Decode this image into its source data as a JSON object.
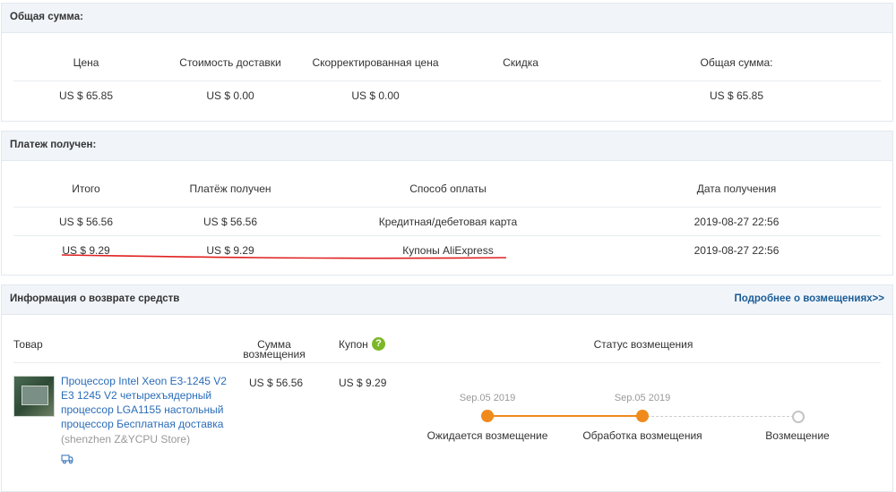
{
  "summary": {
    "title": "Общая сумма:",
    "headers": [
      "Цена",
      "Стоимость доставки",
      "Скорректированная цена",
      "Скидка",
      "Общая сумма:"
    ],
    "values": [
      "US $ 65.85",
      "US $ 0.00",
      "US $ 0.00",
      "",
      "US $ 65.85"
    ]
  },
  "payment": {
    "title": "Платеж получен:",
    "headers": [
      "Итого",
      "Платёж получен",
      "Способ оплаты",
      "Дата получения"
    ],
    "rows": [
      [
        "US $ 56.56",
        "US $ 56.56",
        "Кредитная/дебетовая карта",
        "2019-08-27 22:56"
      ],
      [
        "US $ 9.29",
        "US $ 9.29",
        "Купоны AliExpress",
        "2019-08-27 22:56"
      ]
    ]
  },
  "refund": {
    "title": "Информация о возврате средств",
    "details_link": "Подробнее о возмещениях>>",
    "headers": {
      "product": "Товар",
      "amount_line1": "Сумма",
      "amount_line2": "возмещения",
      "coupon": "Купон",
      "status": "Статус возмещения"
    },
    "item": {
      "title": "Процессор Intel Xeon E3-1245 V2 E3 1245 V2 четырехъядерный процессор LGA1155 настольный процессор Бесплатная доставка",
      "store": "(shenzhen Z&YCPU Store)",
      "amount": "US $ 56.56",
      "coupon": "US $ 9.29"
    },
    "steps": [
      {
        "date": "Sep.05 2019",
        "label": "Ожидается возмещение"
      },
      {
        "date": "Sep.05 2019",
        "label": "Обработка возмещения"
      },
      {
        "date": "",
        "label": "Возмещение"
      }
    ]
  },
  "icons": {
    "help": "question-help-icon",
    "delivery": "delivery-truck-icon",
    "annotation": "red-underline"
  },
  "colors": {
    "accent": "#f08a1c",
    "link": "#2a6cb8",
    "header_bg": "#f1f5fa",
    "underline": "#e02020"
  }
}
